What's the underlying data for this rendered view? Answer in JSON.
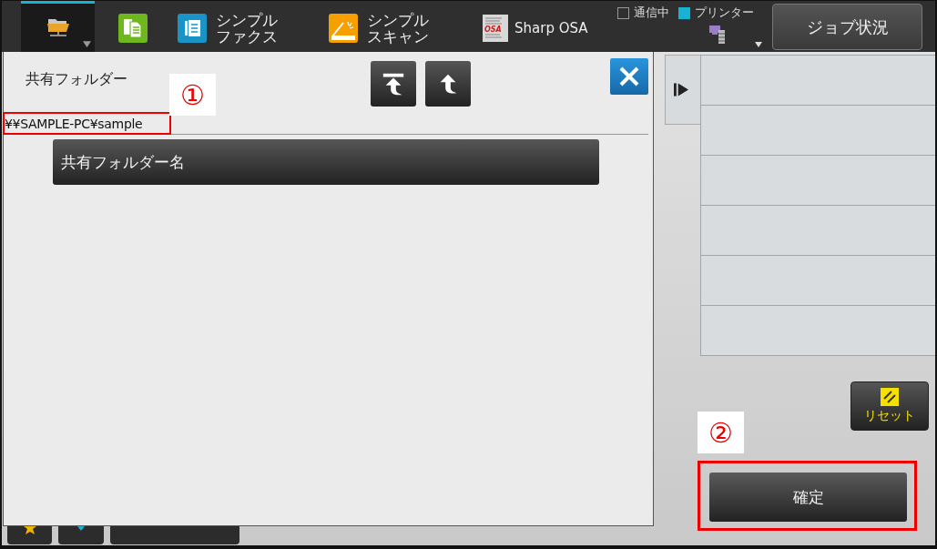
{
  "top_bar": {
    "tabs": [
      {
        "kind": "folder",
        "selected": true,
        "dropdown": true
      },
      {
        "kind": "copy",
        "selected": false,
        "dropdown": false
      },
      {
        "kind": "fax",
        "selected": false,
        "dropdown": false,
        "label_lines": [
          "シンプル",
          "ファクス"
        ]
      },
      {
        "kind": "scan",
        "selected": false,
        "dropdown": false,
        "label_lines": [
          "シンプル",
          "スキャン"
        ]
      },
      {
        "kind": "osa",
        "selected": false,
        "dropdown": false,
        "icon_text": "OSA",
        "label_lines": [
          "Sharp OSA"
        ]
      }
    ],
    "status_indicators": [
      {
        "label": "通信中",
        "on": false
      },
      {
        "label": "プリンター",
        "on": true
      }
    ],
    "job_status_button": "ジョブ状況"
  },
  "dialog": {
    "title": "共有フォルダー",
    "nav_buttons": [
      {
        "kind": "top"
      },
      {
        "kind": "up"
      }
    ],
    "path": "¥¥SAMPLE-PC¥sample",
    "folders": [
      "共有フォルダー名"
    ]
  },
  "bottom_buttons": [
    {
      "kind": "star"
    },
    {
      "kind": "arrow"
    },
    {
      "kind": "wide"
    }
  ],
  "side_panel": {
    "reset_button": "リセット",
    "confirm_button": "確定"
  },
  "annotations": [
    {
      "label": "①"
    },
    {
      "label": "②"
    }
  ]
}
